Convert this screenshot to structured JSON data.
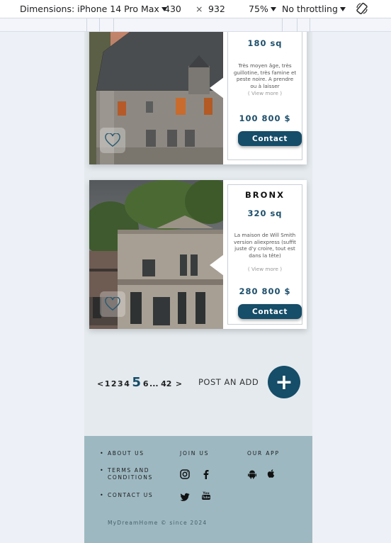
{
  "devtools": {
    "device": "Dimensions: iPhone 14 Pro Max",
    "width": "430",
    "times": "×",
    "height": "932",
    "zoom": "75%",
    "throttling": "No throttling"
  },
  "listings": [
    {
      "title": "",
      "size": "180 sq",
      "description": "Très moyen âge, très guillotine, très famine et peste noire. A prendre ou à laisser",
      "more": "( View more )",
      "price": "100 800 $",
      "contact_label": "Contact"
    },
    {
      "title": "BRONX",
      "size": "320 sq",
      "description": "La maison de Will Smith version aliexpress (suffit juste d'y croire, tout est dans la tête)",
      "more": "( View more )",
      "price": "280 800 $",
      "contact_label": "Contact"
    }
  ],
  "pagination": {
    "prev": "<",
    "pages": [
      "1",
      "2",
      "3",
      "4"
    ],
    "current": "5",
    "next_page": "6",
    "ellipsis": "...",
    "last": "42",
    "next": ">"
  },
  "post_ad": {
    "label": "POST AN ADD",
    "button": "+"
  },
  "footer": {
    "links": [
      "ABOUT US",
      "TERMS AND CONDITIONS",
      "CONTACT US"
    ],
    "join_title": "JOIN US",
    "app_title": "OUR APP",
    "social_icons": [
      "instagram-icon",
      "facebook-icon",
      "twitter-icon",
      "youtube-icon"
    ],
    "app_icons": [
      "android-icon",
      "apple-icon"
    ],
    "copyright": "MyDreamHome © since 2024"
  },
  "colors": {
    "accent": "#164d68",
    "page_bg": "#e4eaee",
    "footer_bg": "#9db8c1"
  }
}
